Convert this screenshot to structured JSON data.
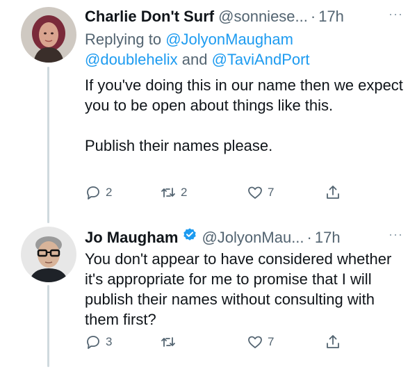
{
  "tweets": [
    {
      "name": "Charlie Don't Surf",
      "handle": "@sonniese...",
      "separator": "·",
      "time": "17h",
      "more": "···",
      "replying_prefix": "Replying to ",
      "replying_to_1": "@JolyonMaugham",
      "replying_to_2": "@doublehelix",
      "replying_and": " and ",
      "replying_to_3": "@TaviAndPort",
      "body_line_1": "If you've doing this in our name then we expect you to be open about things like this.",
      "body_line_2": "Publish their names please.",
      "replies": "2",
      "retweets": "2",
      "likes": "7",
      "avatar_icon": "avatar-woman-dark-hair"
    },
    {
      "name": "Jo Maugham",
      "verified": true,
      "handle": "@JolyonMau...",
      "separator": "·",
      "time": "17h",
      "more": "···",
      "body": "You don't appear to have considered whether it's appropriate for me to promise that I will publish their names without consulting with them first?",
      "replies": "3",
      "retweets": "",
      "likes": "7",
      "avatar_icon": "avatar-man-glasses"
    }
  ],
  "colors": {
    "link": "#1d9bf0",
    "muted": "#536471",
    "text": "#0f1419",
    "thread_line": "#cfd9de"
  }
}
